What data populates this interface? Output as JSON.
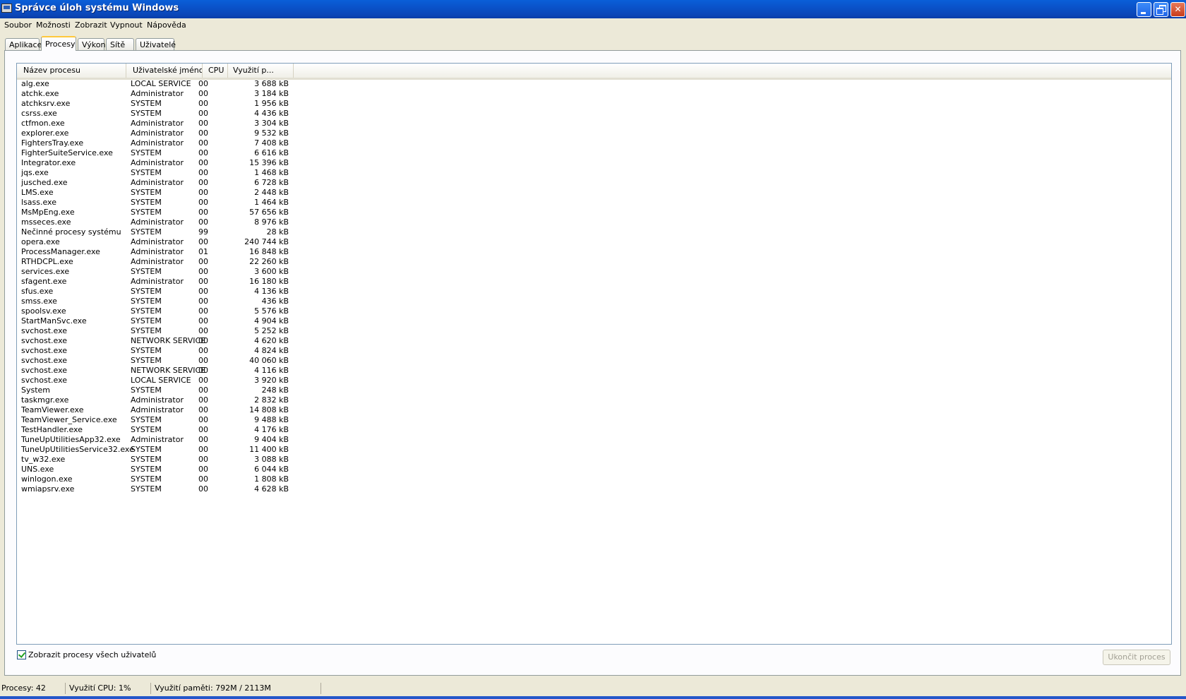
{
  "window": {
    "title": "Správce úloh systému Windows",
    "controls": {
      "minimize": "",
      "restore": "",
      "close": "✕"
    }
  },
  "menu": [
    "Soubor",
    "Možnosti",
    "Zobrazit",
    "Vypnout",
    "Nápověda"
  ],
  "tabs": [
    "Aplikace",
    "Procesy",
    "Výkon",
    "Sítě",
    "Uživatelé"
  ],
  "active_tab": "Procesy",
  "columns": {
    "name": "Název procesu",
    "user": "Uživatelské jméno",
    "cpu": "CPU",
    "mem": "Využití p..."
  },
  "processes": [
    {
      "name": "alg.exe",
      "user": "LOCAL SERVICE",
      "cpu": "00",
      "mem": "3 688 kB"
    },
    {
      "name": "atchk.exe",
      "user": "Administrator",
      "cpu": "00",
      "mem": "3 184 kB"
    },
    {
      "name": "atchksrv.exe",
      "user": "SYSTEM",
      "cpu": "00",
      "mem": "1 956 kB"
    },
    {
      "name": "csrss.exe",
      "user": "SYSTEM",
      "cpu": "00",
      "mem": "4 436 kB"
    },
    {
      "name": "ctfmon.exe",
      "user": "Administrator",
      "cpu": "00",
      "mem": "3 304 kB"
    },
    {
      "name": "explorer.exe",
      "user": "Administrator",
      "cpu": "00",
      "mem": "9 532 kB"
    },
    {
      "name": "FightersTray.exe",
      "user": "Administrator",
      "cpu": "00",
      "mem": "7 408 kB"
    },
    {
      "name": "FighterSuiteService.exe",
      "user": "SYSTEM",
      "cpu": "00",
      "mem": "6 616 kB"
    },
    {
      "name": "Integrator.exe",
      "user": "Administrator",
      "cpu": "00",
      "mem": "15 396 kB"
    },
    {
      "name": "jqs.exe",
      "user": "SYSTEM",
      "cpu": "00",
      "mem": "1 468 kB"
    },
    {
      "name": "jusched.exe",
      "user": "Administrator",
      "cpu": "00",
      "mem": "6 728 kB"
    },
    {
      "name": "LMS.exe",
      "user": "SYSTEM",
      "cpu": "00",
      "mem": "2 448 kB"
    },
    {
      "name": "lsass.exe",
      "user": "SYSTEM",
      "cpu": "00",
      "mem": "1 464 kB"
    },
    {
      "name": "MsMpEng.exe",
      "user": "SYSTEM",
      "cpu": "00",
      "mem": "57 656 kB"
    },
    {
      "name": "msseces.exe",
      "user": "Administrator",
      "cpu": "00",
      "mem": "8 976 kB"
    },
    {
      "name": "Nečinné procesy systému",
      "user": "SYSTEM",
      "cpu": "99",
      "mem": "28 kB"
    },
    {
      "name": "opera.exe",
      "user": "Administrator",
      "cpu": "00",
      "mem": "240 744 kB"
    },
    {
      "name": "ProcessManager.exe",
      "user": "Administrator",
      "cpu": "01",
      "mem": "16 848 kB"
    },
    {
      "name": "RTHDCPL.exe",
      "user": "Administrator",
      "cpu": "00",
      "mem": "22 260 kB"
    },
    {
      "name": "services.exe",
      "user": "SYSTEM",
      "cpu": "00",
      "mem": "3 600 kB"
    },
    {
      "name": "sfagent.exe",
      "user": "Administrator",
      "cpu": "00",
      "mem": "16 180 kB"
    },
    {
      "name": "sfus.exe",
      "user": "SYSTEM",
      "cpu": "00",
      "mem": "4 136 kB"
    },
    {
      "name": "smss.exe",
      "user": "SYSTEM",
      "cpu": "00",
      "mem": "436 kB"
    },
    {
      "name": "spoolsv.exe",
      "user": "SYSTEM",
      "cpu": "00",
      "mem": "5 576 kB"
    },
    {
      "name": "StartManSvc.exe",
      "user": "SYSTEM",
      "cpu": "00",
      "mem": "4 904 kB"
    },
    {
      "name": "svchost.exe",
      "user": "SYSTEM",
      "cpu": "00",
      "mem": "5 252 kB"
    },
    {
      "name": "svchost.exe",
      "user": "NETWORK SERVICE",
      "cpu": "00",
      "mem": "4 620 kB"
    },
    {
      "name": "svchost.exe",
      "user": "SYSTEM",
      "cpu": "00",
      "mem": "4 824 kB"
    },
    {
      "name": "svchost.exe",
      "user": "SYSTEM",
      "cpu": "00",
      "mem": "40 060 kB"
    },
    {
      "name": "svchost.exe",
      "user": "NETWORK SERVICE",
      "cpu": "00",
      "mem": "4 116 kB"
    },
    {
      "name": "svchost.exe",
      "user": "LOCAL SERVICE",
      "cpu": "00",
      "mem": "3 920 kB"
    },
    {
      "name": "System",
      "user": "SYSTEM",
      "cpu": "00",
      "mem": "248 kB"
    },
    {
      "name": "taskmgr.exe",
      "user": "Administrator",
      "cpu": "00",
      "mem": "2 832 kB"
    },
    {
      "name": "TeamViewer.exe",
      "user": "Administrator",
      "cpu": "00",
      "mem": "14 808 kB"
    },
    {
      "name": "TeamViewer_Service.exe",
      "user": "SYSTEM",
      "cpu": "00",
      "mem": "9 488 kB"
    },
    {
      "name": "TestHandler.exe",
      "user": "SYSTEM",
      "cpu": "00",
      "mem": "4 176 kB"
    },
    {
      "name": "TuneUpUtilitiesApp32.exe",
      "user": "Administrator",
      "cpu": "00",
      "mem": "9 404 kB"
    },
    {
      "name": "TuneUpUtilitiesService32.exe",
      "user": "SYSTEM",
      "cpu": "00",
      "mem": "11 400 kB"
    },
    {
      "name": "tv_w32.exe",
      "user": "SYSTEM",
      "cpu": "00",
      "mem": "3 088 kB"
    },
    {
      "name": "UNS.exe",
      "user": "SYSTEM",
      "cpu": "00",
      "mem": "6 044 kB"
    },
    {
      "name": "winlogon.exe",
      "user": "SYSTEM",
      "cpu": "00",
      "mem": "1 808 kB"
    },
    {
      "name": "wmiapsrv.exe",
      "user": "SYSTEM",
      "cpu": "00",
      "mem": "4 628 kB"
    }
  ],
  "show_all_users": {
    "label": "Zobrazit procesy všech uživatelů",
    "checked": true
  },
  "end_process_button": "Ukončit proces",
  "status": {
    "processes": "Procesy: 42",
    "cpu": "Využití CPU: 1%",
    "memory": "Využití paměti: 792M / 2113M"
  }
}
